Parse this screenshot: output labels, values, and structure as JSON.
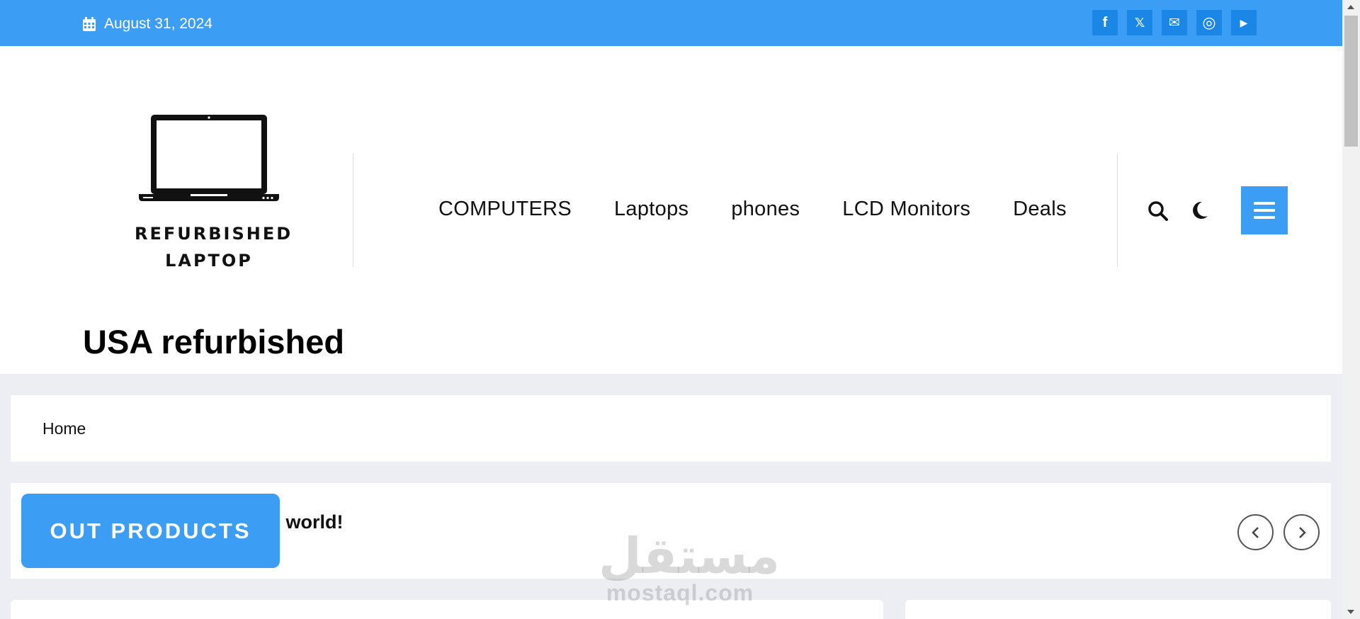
{
  "topbar": {
    "date": "August 31, 2024",
    "socials": [
      {
        "icon": "facebook-icon",
        "glyph": "f"
      },
      {
        "icon": "x-twitter-icon",
        "glyph": "𝕏"
      },
      {
        "icon": "email-icon",
        "glyph": "✉"
      },
      {
        "icon": "instagram-icon",
        "glyph": "◎"
      },
      {
        "icon": "youtube-icon",
        "glyph": "▶"
      }
    ]
  },
  "logo": {
    "line1": "REFURBISHED",
    "line2": "LAPTOP"
  },
  "nav": {
    "items": [
      "COMPUTERS",
      "Laptops",
      "phones",
      "LCD Monitors",
      "Deals"
    ]
  },
  "site_title": "USA refurbished",
  "breadcrumb": {
    "home": "Home"
  },
  "ticker": {
    "badge": "OUT PRODUCTS",
    "text": "Hello world!"
  },
  "watermark": {
    "arabic": "مستقل",
    "latin": "mostaql.com"
  },
  "colors": {
    "accent": "#3b9df4",
    "social_bg": "#1a86e6",
    "page_bg": "#eceef4"
  }
}
